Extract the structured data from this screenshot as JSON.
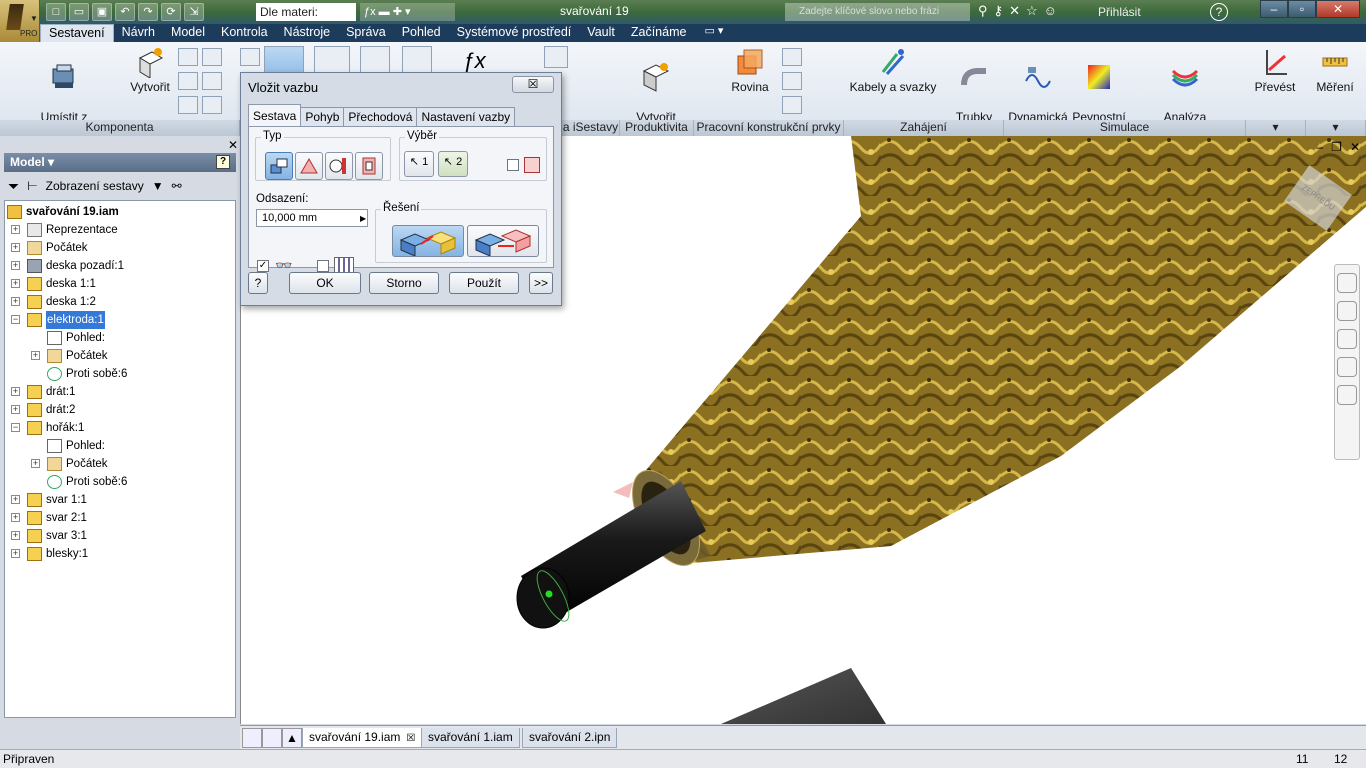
{
  "title_bar": {
    "app_badge": "PRO",
    "doc_field": "Dle materi:",
    "window_title": "svařování 19",
    "search_placeholder": "Zadejte klíčové slovo nebo frázi",
    "sign_in": "Přihlásit",
    "help": "?"
  },
  "ribbon_tabs": [
    "Sestavení",
    "Návrh",
    "Model",
    "Kontrola",
    "Nástroje",
    "Správa",
    "Pohled",
    "Systémové prostředí",
    "Vault",
    "Začínáme"
  ],
  "ribbon": {
    "place_from_content_center": "Umístit z\nObsahového centra",
    "create": "Vytvořit",
    "create_substitute": "Vytvořit\nnáhrady",
    "plane": "Rovina",
    "cables": "Kabely a svazky",
    "tubes": "Trubky\na potrubí",
    "dynamic_sim": "Dynamická\nsimulace",
    "stress": "Pevnostní\nanalýza",
    "frame_analysis": "Analýza\nrámových konstrukcí",
    "convert": "Převést",
    "measure": "Měření",
    "panels": {
      "component": "Komponenta",
      "iassembly": "a iSestavy",
      "productivity": "Produktivita",
      "work_features": "Pracovní konstrukční prvky",
      "begin": "Zahájení",
      "simulation": "Simulace"
    }
  },
  "browser": {
    "header": "Model",
    "view_select": "Zobrazení sestavy",
    "tree": [
      {
        "label": "svařování 19.iam",
        "level": 0,
        "icon": "assembly-icon",
        "bold": true
      },
      {
        "label": "Reprezentace",
        "level": 1,
        "icon": "representations-icon"
      },
      {
        "label": "Počátek",
        "level": 1,
        "icon": "folder-icon"
      },
      {
        "label": "deska pozadí:1",
        "level": 1,
        "icon": "grounded-part-icon"
      },
      {
        "label": "deska 1:1",
        "level": 1,
        "icon": "part-icon"
      },
      {
        "label": "deska 1:2",
        "level": 1,
        "icon": "part-icon"
      },
      {
        "label": "elektroda:1",
        "level": 1,
        "icon": "part-icon",
        "selected": true
      },
      {
        "label": "Pohled:",
        "level": 2,
        "icon": "view-icon"
      },
      {
        "label": "Počátek",
        "level": 2,
        "icon": "folder-icon"
      },
      {
        "label": "Proti sobě:6",
        "level": 2,
        "icon": "mate-icon"
      },
      {
        "label": "drát:1",
        "level": 1,
        "icon": "part-icon"
      },
      {
        "label": "drát:2",
        "level": 1,
        "icon": "part-icon"
      },
      {
        "label": "hořák:1",
        "level": 1,
        "icon": "part-icon"
      },
      {
        "label": "Pohled:",
        "level": 2,
        "icon": "view-icon"
      },
      {
        "label": "Počátek",
        "level": 2,
        "icon": "folder-icon"
      },
      {
        "label": "Proti sobě:6",
        "level": 2,
        "icon": "mate-icon"
      },
      {
        "label": "svar 1:1",
        "level": 1,
        "icon": "part-icon"
      },
      {
        "label": "svar 2:1",
        "level": 1,
        "icon": "part-icon"
      },
      {
        "label": "svar 3:1",
        "level": 1,
        "icon": "part-icon"
      },
      {
        "label": "blesky:1",
        "level": 1,
        "icon": "part-icon"
      }
    ]
  },
  "dialog": {
    "title": "Vložit vazbu",
    "close": "☒",
    "tabs": [
      "Sestava",
      "Pohyb",
      "Přechodová",
      "Nastavení vazby"
    ],
    "type_label": "Typ",
    "selection_label": "Výběr",
    "sel1": "1",
    "sel2": "2",
    "offset_label": "Odsazení:",
    "offset_value": "10,000 mm",
    "solution_label": "Řešení",
    "ok": "OK",
    "cancel": "Storno",
    "apply": "Použít",
    "more": ">>",
    "help": "?"
  },
  "doc_tabs": [
    "svařování 19.iam",
    "svařování 1.iam",
    "svařování 2.ipn"
  ],
  "status": {
    "text": "Připraven",
    "n1": "11",
    "n2": "12"
  },
  "viewcube_label": "ZEPŘEDU"
}
